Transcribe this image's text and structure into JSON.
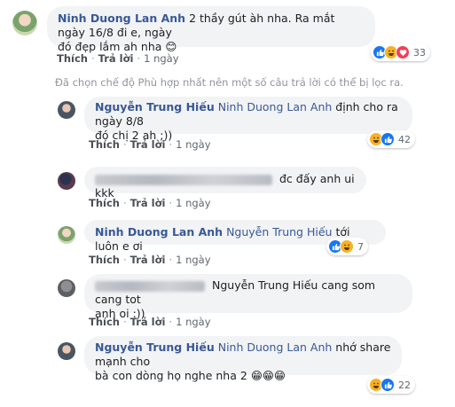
{
  "comments": [
    {
      "author": "Ninh Duong Lan Anh",
      "line1": "2 thầy gút àh nha. Ra mắt ngày 16/8 đi e, ngày",
      "line2": "đó đẹp lắm ah nha",
      "emoji": "😊",
      "actions": {
        "like": "Thích",
        "reply": "Trả lời",
        "time": "1 ngày"
      },
      "reactions": {
        "count": "33",
        "icons": [
          "like-icon",
          "haha-icon",
          "love-icon"
        ]
      }
    },
    {
      "author": "Nguyễn Trung Hiếu",
      "mention": "Ninh Duong Lan Anh",
      "line1": "định cho ra ngày 8/8",
      "line2": "đó chị 2 ah ;))",
      "actions": {
        "like": "Thích",
        "reply": "Trả lời",
        "time": "1 ngày"
      },
      "reactions": {
        "count": "42",
        "icons": [
          "haha-icon",
          "like-icon"
        ]
      }
    },
    {
      "author": "",
      "line1": "đc đấy anh ui kkk",
      "actions": {
        "like": "Thích",
        "reply": "Trả lời",
        "time": "1 ngày"
      }
    },
    {
      "author": "Ninh Duong Lan Anh",
      "mention": "Nguyễn Trung Hiếu",
      "line1": "tới luôn e ơi",
      "actions": {
        "like": "Thích",
        "reply": "Trả lời",
        "time": "1 ngày"
      },
      "reactions": {
        "count": "7",
        "icons": [
          "like-icon",
          "haha-icon"
        ]
      }
    },
    {
      "author": "",
      "mention": "Nguyễn Trung Hiếu",
      "line1": "cang som cang tot",
      "line2": "anh oi :))",
      "actions": {
        "like": "Thích",
        "reply": "Trả lời",
        "time": "1 ngày"
      }
    },
    {
      "author": "Nguyễn Trung Hiếu",
      "mention": "Ninh Duong Lan Anh",
      "line1": "nhớ share mạnh cho",
      "line2": "bà con dòng họ nghe nha 2",
      "emoji": "😁😁😁",
      "actions": {
        "like": "Thích",
        "reply": "Trả lời",
        "time": "1 ngày"
      },
      "reactions": {
        "count": "22",
        "icons": [
          "haha-icon",
          "like-icon"
        ]
      }
    }
  ],
  "filter_note": "Đã chọn chế độ Phù hợp nhất nên một số câu trả lời có thể bị lọc ra.",
  "colors": {
    "author": "#385898",
    "bubble": "#f2f3f5",
    "like": "#1877f2",
    "love": "#f33e58",
    "haha": "#f7b125"
  }
}
